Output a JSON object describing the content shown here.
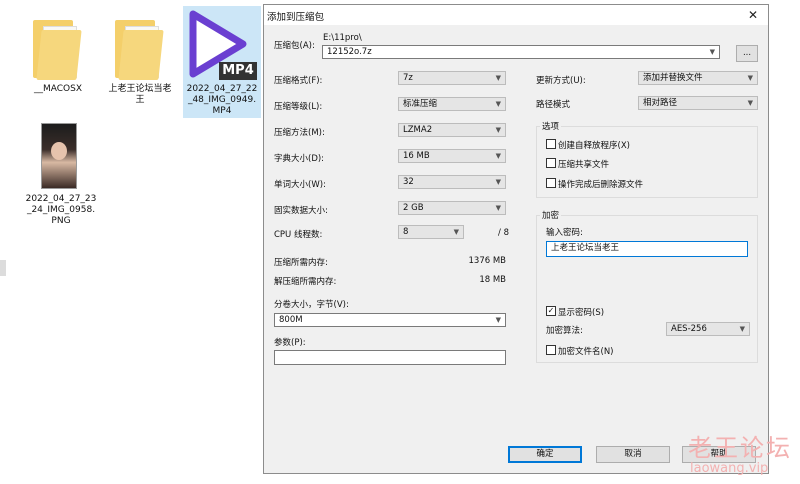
{
  "desktop": {
    "files": [
      {
        "name": "__MACOSX"
      },
      {
        "name": "上老王论坛当老王"
      },
      {
        "name": "2022_04_27_22_48_IMG_0949.MP4",
        "badge": "MP4"
      },
      {
        "name": "2022_04_27_23_24_IMG_0958.PNG"
      }
    ],
    "file2_line1": "2022_04_27_22",
    "file2_line2": "_48_IMG_0949.",
    "file2_line3": "MP4",
    "file3_line1": "2022_04_27_23",
    "file3_line2": "_24_IMG_0958.",
    "file3_line3": "PNG",
    "file1_line1": "上老王论坛当老",
    "file1_line2": "王"
  },
  "dialog": {
    "title": "添加到压缩包",
    "close_glyph": "✕",
    "archive_label": "压缩包(A):",
    "archive_path": "E:\\11pro\\",
    "archive_name": "12152o.7z",
    "browse_label": "...",
    "left": {
      "format_label": "压缩格式(F):",
      "format_value": "7z",
      "level_label": "压缩等级(L):",
      "level_value": "标准压缩",
      "method_label": "压缩方法(M):",
      "method_value": "LZMA2",
      "dict_label": "字典大小(D):",
      "dict_value": "16 MB",
      "word_label": "单词大小(W):",
      "word_value": "32",
      "solid_label": "固实数据大小:",
      "solid_value": "2 GB",
      "threads_label": "CPU 线程数:",
      "threads_value": "8",
      "threads_max": "/ 8",
      "mem_comp_label": "压缩所需内存:",
      "mem_comp_value": "1376 MB",
      "mem_decomp_label": "解压缩所需内存:",
      "mem_decomp_value": "18 MB",
      "split_label": "分卷大小，字节(V):",
      "split_value": "800M",
      "params_label": "参数(P):",
      "params_value": ""
    },
    "right": {
      "update_label": "更新方式(U):",
      "update_value": "添加并替换文件",
      "path_label": "路径模式",
      "path_value": "相对路径",
      "options_title": "选项",
      "opt_sfx": "创建自释放程序(X)",
      "opt_shared": "压缩共享文件",
      "opt_delete": "操作完成后删除源文件",
      "encrypt_title": "加密",
      "password_label": "输入密码:",
      "password_value": "上老王论坛当老王",
      "show_password": "显示密码(S)",
      "show_password_checked": "✓",
      "algo_label": "加密算法:",
      "algo_value": "AES-256",
      "encrypt_names": "加密文件名(N)"
    },
    "buttons": {
      "ok": "确定",
      "cancel": "取消",
      "help": "帮助"
    }
  },
  "watermark": {
    "line1": "老王论坛",
    "line2": "laowang.vip"
  }
}
